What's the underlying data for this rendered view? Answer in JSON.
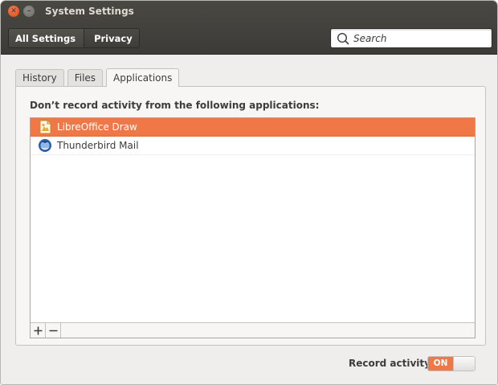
{
  "window": {
    "title": "System Settings"
  },
  "toolbar": {
    "breadcrumbs": [
      "All Settings",
      "Privacy"
    ],
    "search_placeholder": "Search"
  },
  "tabs": [
    {
      "label": "History",
      "active": false
    },
    {
      "label": "Files",
      "active": false
    },
    {
      "label": "Applications",
      "active": true
    }
  ],
  "applications_panel": {
    "heading": "Don’t record activity from the following applications:",
    "apps": [
      {
        "name": "LibreOffice Draw",
        "icon": "libreoffice-draw-icon",
        "selected": true
      },
      {
        "name": "Thunderbird Mail",
        "icon": "thunderbird-icon",
        "selected": false
      }
    ],
    "add_symbol": "+",
    "remove_symbol": "−"
  },
  "record_activity": {
    "label": "Record activity",
    "state": "ON"
  },
  "colors": {
    "accent": "#f07746",
    "header": "#3c3b37",
    "close_button": "#df4a16"
  }
}
